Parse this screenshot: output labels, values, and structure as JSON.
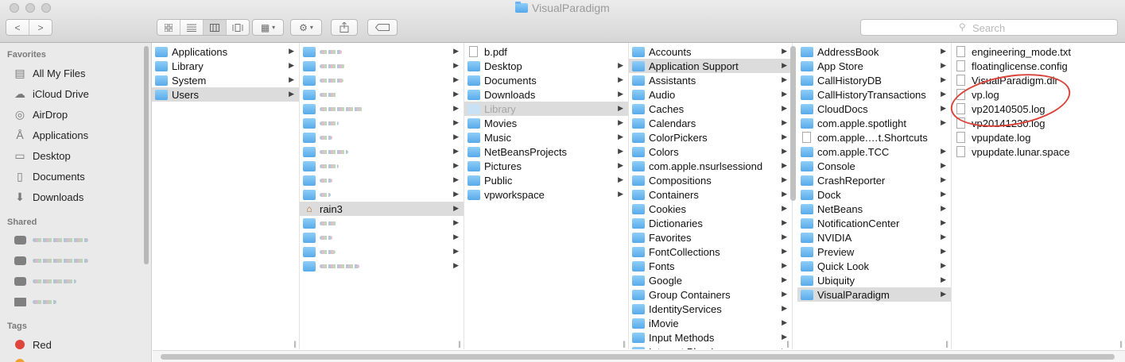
{
  "window": {
    "title": "VisualParadigm"
  },
  "toolbar": {
    "back": "<",
    "forward": ">",
    "view_modes": [
      "icon-view",
      "list-view",
      "column-view",
      "cover-flow-view"
    ],
    "active_view": "column-view",
    "search_placeholder": "Search"
  },
  "sidebar": {
    "favorites_header": "Favorites",
    "favorites": [
      {
        "label": "All My Files",
        "icon": "all-files-icon"
      },
      {
        "label": "iCloud Drive",
        "icon": "cloud-icon"
      },
      {
        "label": "AirDrop",
        "icon": "airdrop-icon"
      },
      {
        "label": "Applications",
        "icon": "applications-icon"
      },
      {
        "label": "Desktop",
        "icon": "desktop-icon"
      },
      {
        "label": "Documents",
        "icon": "documents-icon"
      },
      {
        "label": "Downloads",
        "icon": "downloads-icon"
      }
    ],
    "shared_header": "Shared",
    "shared_count": 4,
    "tags_header": "Tags",
    "tags": [
      {
        "label": "Red",
        "color": "#e0453b"
      }
    ]
  },
  "columns": {
    "root": [
      {
        "label": "Applications",
        "icon": "folder",
        "arrow": true
      },
      {
        "label": "Library",
        "icon": "folder",
        "arrow": true
      },
      {
        "label": "System",
        "icon": "system-folder",
        "arrow": true
      },
      {
        "label": "Users",
        "icon": "folder",
        "arrow": true,
        "selected": true
      }
    ],
    "users": [
      {
        "label": "",
        "blurred": true,
        "arrow": true
      },
      {
        "label": "",
        "blurred": true,
        "arrow": true
      },
      {
        "label": "",
        "blurred": true,
        "arrow": true
      },
      {
        "label": "",
        "blurred": true,
        "arrow": true
      },
      {
        "label": "",
        "blurred": true,
        "arrow": true
      },
      {
        "label": "",
        "blurred": true,
        "arrow": true
      },
      {
        "label": "",
        "blurred": true,
        "arrow": true
      },
      {
        "label": "",
        "blurred": true,
        "arrow": true
      },
      {
        "label": "",
        "blurred": true,
        "arrow": true
      },
      {
        "label": "",
        "blurred": true,
        "arrow": true
      },
      {
        "label": "",
        "blurred": true,
        "arrow": true
      },
      {
        "label": "rain3",
        "icon": "home",
        "arrow": true,
        "selected": true
      },
      {
        "label": "",
        "blurred": true,
        "arrow": true
      },
      {
        "label": "",
        "blurred": true,
        "arrow": true
      },
      {
        "label": "",
        "blurred": true,
        "arrow": true
      },
      {
        "label": "",
        "blurred": true,
        "arrow": true
      }
    ],
    "home": [
      {
        "label": "b.pdf",
        "icon": "doc",
        "arrow": false
      },
      {
        "label": "Desktop",
        "icon": "folder",
        "arrow": true
      },
      {
        "label": "Documents",
        "icon": "folder",
        "arrow": true
      },
      {
        "label": "Downloads",
        "icon": "folder",
        "arrow": true
      },
      {
        "label": "Library",
        "icon": "folder-pale",
        "arrow": true,
        "selected": true,
        "dim": true
      },
      {
        "label": "Movies",
        "icon": "folder",
        "arrow": true
      },
      {
        "label": "Music",
        "icon": "folder",
        "arrow": true
      },
      {
        "label": "NetBeansProjects",
        "icon": "folder",
        "arrow": true
      },
      {
        "label": "Pictures",
        "icon": "folder",
        "arrow": true
      },
      {
        "label": "Public",
        "icon": "folder",
        "arrow": true
      },
      {
        "label": "vpworkspace",
        "icon": "folder",
        "arrow": true
      }
    ],
    "library": [
      {
        "label": "Accounts",
        "icon": "folder",
        "arrow": true
      },
      {
        "label": "Application Support",
        "icon": "folder",
        "arrow": true,
        "selected": true
      },
      {
        "label": "Assistants",
        "icon": "folder",
        "arrow": true
      },
      {
        "label": "Audio",
        "icon": "folder",
        "arrow": true
      },
      {
        "label": "Caches",
        "icon": "folder",
        "arrow": true
      },
      {
        "label": "Calendars",
        "icon": "folder",
        "arrow": true
      },
      {
        "label": "ColorPickers",
        "icon": "folder",
        "arrow": true
      },
      {
        "label": "Colors",
        "icon": "folder",
        "arrow": true
      },
      {
        "label": "com.apple.nsurlsessiond",
        "icon": "folder",
        "arrow": true
      },
      {
        "label": "Compositions",
        "icon": "folder",
        "arrow": true
      },
      {
        "label": "Containers",
        "icon": "folder",
        "arrow": true
      },
      {
        "label": "Cookies",
        "icon": "folder",
        "arrow": true
      },
      {
        "label": "Dictionaries",
        "icon": "folder",
        "arrow": true
      },
      {
        "label": "Favorites",
        "icon": "folder",
        "arrow": true
      },
      {
        "label": "FontCollections",
        "icon": "folder",
        "arrow": true
      },
      {
        "label": "Fonts",
        "icon": "folder",
        "arrow": true
      },
      {
        "label": "Google",
        "icon": "folder",
        "arrow": true
      },
      {
        "label": "Group Containers",
        "icon": "folder",
        "arrow": true
      },
      {
        "label": "IdentityServices",
        "icon": "folder",
        "arrow": true
      },
      {
        "label": "iMovie",
        "icon": "folder",
        "arrow": true
      },
      {
        "label": "Input Methods",
        "icon": "folder",
        "arrow": true
      },
      {
        "label": "Internet Plug-Ins",
        "icon": "folder",
        "arrow": true
      }
    ],
    "app_support": [
      {
        "label": "AddressBook",
        "icon": "folder",
        "arrow": true
      },
      {
        "label": "App Store",
        "icon": "folder",
        "arrow": true
      },
      {
        "label": "CallHistoryDB",
        "icon": "folder",
        "arrow": true
      },
      {
        "label": "CallHistoryTransactions",
        "icon": "folder",
        "arrow": true
      },
      {
        "label": "CloudDocs",
        "icon": "folder",
        "arrow": true
      },
      {
        "label": "com.apple.spotlight",
        "icon": "folder",
        "arrow": true
      },
      {
        "label": "com.apple.…t.Shortcuts",
        "icon": "doc",
        "arrow": false
      },
      {
        "label": "com.apple.TCC",
        "icon": "folder",
        "arrow": true
      },
      {
        "label": "Console",
        "icon": "folder",
        "arrow": true
      },
      {
        "label": "CrashReporter",
        "icon": "folder",
        "arrow": true
      },
      {
        "label": "Dock",
        "icon": "folder",
        "arrow": true
      },
      {
        "label": "NetBeans",
        "icon": "folder",
        "arrow": true
      },
      {
        "label": "NotificationCenter",
        "icon": "folder",
        "arrow": true
      },
      {
        "label": "NVIDIA",
        "icon": "folder",
        "arrow": true
      },
      {
        "label": "Preview",
        "icon": "folder",
        "arrow": true
      },
      {
        "label": "Quick Look",
        "icon": "folder",
        "arrow": true
      },
      {
        "label": "Ubiquity",
        "icon": "folder",
        "arrow": true
      },
      {
        "label": "VisualParadigm",
        "icon": "folder",
        "arrow": true,
        "selected": true
      }
    ],
    "visualparadigm": [
      {
        "label": "engineering_mode.txt",
        "icon": "doc",
        "arrow": false
      },
      {
        "label": "floatinglicense.config",
        "icon": "doc",
        "arrow": false
      },
      {
        "label": "VisualParadigm.dir",
        "icon": "doc",
        "arrow": false
      },
      {
        "label": "vp.log",
        "icon": "doc",
        "arrow": false
      },
      {
        "label": "vp20140505.log",
        "icon": "doc",
        "arrow": false
      },
      {
        "label": "vp20141230.log",
        "icon": "doc",
        "arrow": false
      },
      {
        "label": "vpupdate.log",
        "icon": "doc",
        "arrow": false
      },
      {
        "label": "vpupdate.lunar.space",
        "icon": "doc",
        "arrow": false
      }
    ]
  },
  "annotation": {
    "highlight": "vp.log",
    "color": "#d9453b"
  }
}
